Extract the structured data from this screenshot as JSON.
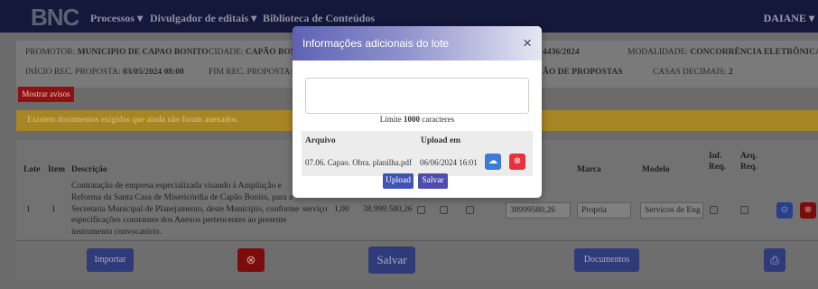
{
  "nav": {
    "logo": "BNC",
    "items": [
      "Processos ▾",
      "Divulgador de editais ▾",
      "Biblioteca de Conteúdos"
    ],
    "user": "DAIANE ▾"
  },
  "info": {
    "promotor_label": "PROMOTOR:",
    "promotor_value": "MUNICIPIO DE CAPAO BONITO",
    "cidade_label": "CIDADE:",
    "cidade_value": "CAPÃO BON",
    "numero_value": "4436/2024",
    "modalidade_label": "MODALIDADE:",
    "modalidade_value": "CONCORRÊNCIA ELETRÔNICA",
    "inicio_label": "INÍCIO REC. PROPOSTA:",
    "inicio_value": "03/05/2024 08:00",
    "fim_label": "FIM REC. PROPOSTA:",
    "fim_value": "(",
    "fase_value": "ÃO DE PROPOSTAS",
    "casas_label": "CASAS DECIMAIS:",
    "casas_value": "2"
  },
  "avisos_button": "Mostrar avisos",
  "warning_text": "Existem documentos exigidos que ainda não foram anexados.",
  "table": {
    "headers": {
      "lote": "Lote",
      "item": "Item",
      "descricao": "Descrição",
      "marca": "Marca",
      "modelo": "Modelo",
      "inf_req": "Inf.\nReq.",
      "arq_req": "Arq.\nReq."
    },
    "row": {
      "lote": "1",
      "item": "1",
      "descricao": "Contratação de empresa especializada visando à Ampliação e Reforma da Santa Casa de Misericórdia de Capão Bonito, para a Secretaria Municipal de Planejamento, deste Município, conforme especificações constantes dos Anexos pertencentes ao presente instrumento convocatório.",
      "unidade": "serviço",
      "quantidade": "1,00",
      "valor": "38.999.580,26",
      "valor_input": "38999580,26",
      "marca": "Propria",
      "modelo": "Servicos de Eng"
    }
  },
  "footer": {
    "importar": "Importar",
    "salvar": "Salvar",
    "documentos": "Documentos"
  },
  "modal": {
    "title": "Informações adicionais do lote",
    "close": "×",
    "textarea_value": "",
    "limite_prefix": "Limite",
    "limite_value": "1000",
    "limite_suffix": "caracteres",
    "col_arquivo": "Arquivo",
    "col_upload": "Upload em",
    "file_name": "07.06. Capao. Obra. planilha.pdf",
    "file_date": "06/06/2024 16:01",
    "upload_button": "Upload",
    "salvar_button": "Salvar"
  },
  "colors": {
    "topbar": "#14183a",
    "modal_header_start": "#5f62b4",
    "danger": "#e8313a",
    "primary": "#3f55b3",
    "warning": "#a88524"
  }
}
